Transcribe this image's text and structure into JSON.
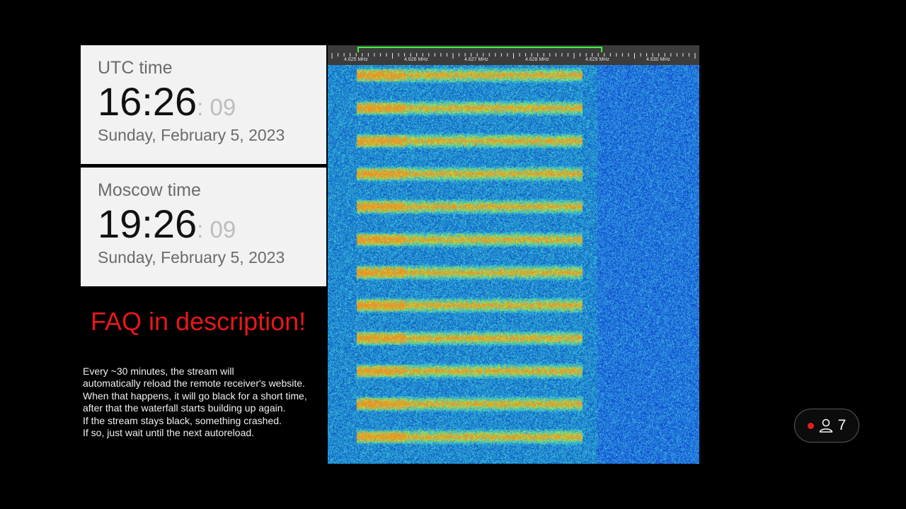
{
  "clocks": {
    "utc": {
      "label": "UTC time",
      "hm": "16:26",
      "sec": ": 09",
      "date": "Sunday, February 5, 2023"
    },
    "moscow": {
      "label": "Moscow time",
      "hm": "19:26",
      "sec": ": 09",
      "date": "Sunday, February 5, 2023"
    }
  },
  "faq": {
    "text": "FAQ in description!",
    "color": "#e8171a"
  },
  "notice": {
    "lines": [
      "Every ~30 minutes, the stream will",
      "automatically reload the remote receiver's website.",
      "When that happens, it will go black for a short time,",
      "after that the waterfall starts building up again.",
      "If the stream stays black, something crashed.",
      "If so, just wait until the next autoreload."
    ]
  },
  "waterfall": {
    "frequency_labels": [
      "4.625 MHz",
      "4.626 MHz",
      "4.627 MHz",
      "4.628 MHz",
      "4.629 MHz",
      "4.630 MHz"
    ],
    "colors": {
      "background": "#29a9d6",
      "signal": "#8fe34a",
      "passband": "#3cf23c"
    }
  },
  "viewers": {
    "icon": "person-icon",
    "count": "7",
    "live_color": "#e02020"
  }
}
